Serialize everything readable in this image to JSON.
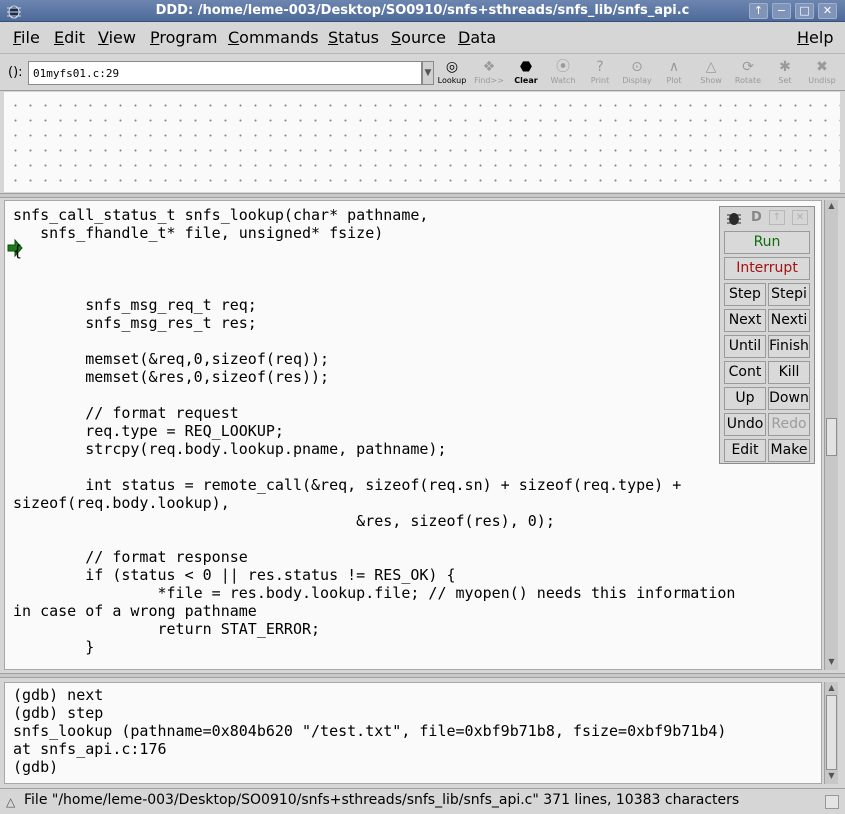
{
  "window": {
    "title": "DDD: /home/leme-003/Desktop/SO0910/snfs+sthreads/snfs_lib/snfs_api.c",
    "controls": [
      "↑",
      "−",
      "□",
      "✕"
    ]
  },
  "menubar": {
    "items": [
      {
        "first": "F",
        "rest": "ile"
      },
      {
        "first": "E",
        "rest": "dit"
      },
      {
        "first": "V",
        "rest": "iew"
      },
      {
        "first": "P",
        "rest": "rogram"
      },
      {
        "first": "C",
        "rest": "ommands"
      },
      {
        "first": "S",
        "rest": "tatus"
      },
      {
        "first": "S",
        "rest": "ource"
      },
      {
        "first": "D",
        "rest": "ata"
      },
      {
        "first": "H",
        "rest": "elp"
      }
    ]
  },
  "toolbar": {
    "arg_label": "():",
    "arg_value": "01myfs01.c:29",
    "buttons": [
      {
        "label": "Lookup",
        "icon": "◎"
      },
      {
        "label": "Find>>",
        "icon": "❖"
      },
      {
        "label": "Clear",
        "icon": "⬣"
      },
      {
        "label": "Watch",
        "icon": "⦿"
      },
      {
        "label": "Print",
        "icon": "?"
      },
      {
        "label": "Display",
        "icon": "⊙"
      },
      {
        "label": "Plot",
        "icon": "∧"
      },
      {
        "label": "Show",
        "icon": "△"
      },
      {
        "label": "Rotate",
        "icon": "⟳"
      },
      {
        "label": "Set",
        "icon": "✱"
      },
      {
        "label": "Undisp",
        "icon": "✖"
      }
    ]
  },
  "source": {
    "code": "snfs_call_status_t snfs_lookup(char* pathname,\n   snfs_fhandle_t* file, unsigned* fsize)\n{\n\n\n        snfs_msg_req_t req;\n        snfs_msg_res_t res;\n\n        memset(&req,0,sizeof(req));\n        memset(&res,0,sizeof(res));\n\n        // format request\n        req.type = REQ_LOOKUP;\n        strcpy(req.body.lookup.pname, pathname);\n\n        int status = remote_call(&req, sizeof(req.sn) + sizeof(req.type) +\nsizeof(req.body.lookup),\n                                      &res, sizeof(res), 0);\n\n        // format response\n        if (status < 0 || res.status != RES_OK) {\n                *file = res.body.lookup.file; // myopen() needs this information\nin case of a wrong pathname\n                return STAT_ERROR;\n        }"
  },
  "command_tool": {
    "title_letter": "D",
    "run": "Run",
    "interrupt": "Interrupt",
    "grid": [
      [
        "Step",
        "Stepi"
      ],
      [
        "Next",
        "Nexti"
      ],
      [
        "Until",
        "Finish"
      ],
      [
        "Cont",
        "Kill"
      ],
      [
        "Up",
        "Down"
      ],
      [
        "Undo",
        "Redo"
      ],
      [
        "Edit",
        "Make"
      ]
    ]
  },
  "console": {
    "text": "(gdb) next\n(gdb) step\nsnfs_lookup (pathname=0x804b620 \"/test.txt\", file=0xbf9b71b8, fsize=0xbf9b71b4)\nat snfs_api.c:176\n(gdb)"
  },
  "statusbar": {
    "text": "File \"/home/leme-003/Desktop/SO0910/snfs+sthreads/snfs_lib/snfs_api.c\" 371 lines, 10383 characters"
  }
}
